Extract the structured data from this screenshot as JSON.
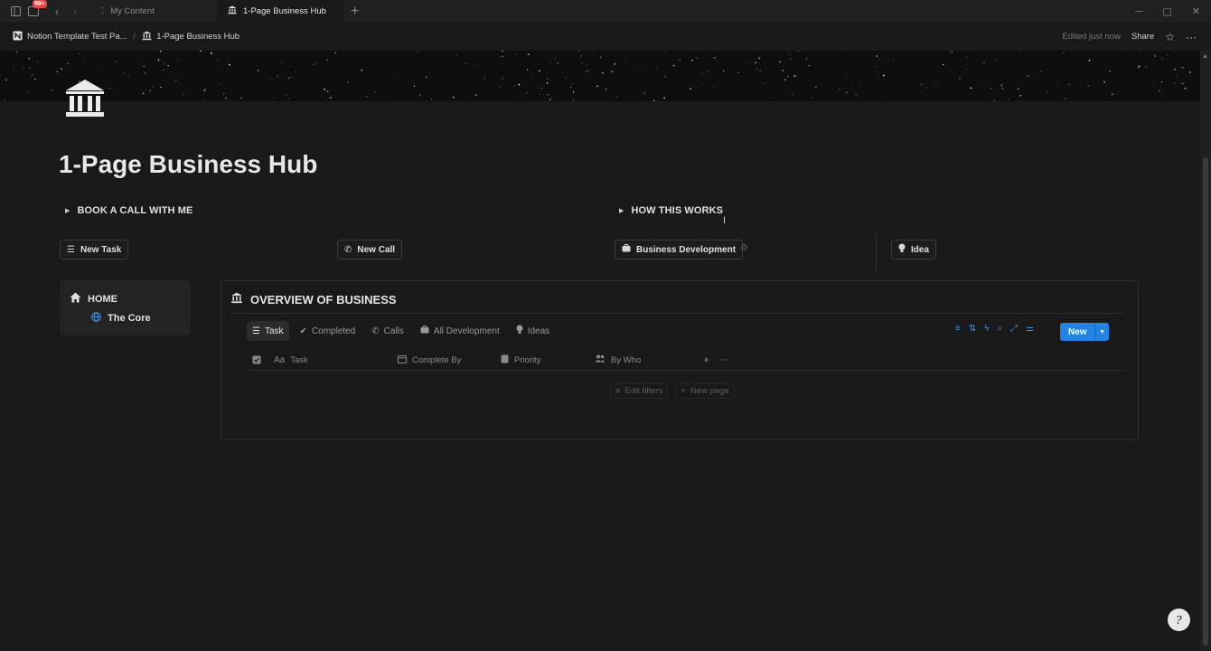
{
  "titlebar": {
    "badge": "99+",
    "tabs": [
      {
        "label": "My Content",
        "icon": "dots-icon",
        "active": false
      },
      {
        "label": "1-Page Business Hub",
        "icon": "bank-icon",
        "active": true
      }
    ],
    "add_tab": "+"
  },
  "topbar": {
    "breadcrumbs": [
      {
        "label": "Notion Template Test Pa...",
        "icon": "notion-icon"
      },
      {
        "label": "1-Page Business Hub",
        "icon": "bank-icon"
      }
    ],
    "edited": "Edited just now",
    "share": "Share"
  },
  "page": {
    "title": "1-Page Business Hub",
    "toggles": [
      "BOOK A CALL WITH ME",
      "HOW THIS WORKS"
    ],
    "buttons": {
      "new_task": "New Task",
      "new_call": "New Call",
      "business_development": "Business Development",
      "idea": "Idea"
    }
  },
  "sidebar": {
    "home": "HOME",
    "core": "The Core"
  },
  "database": {
    "title": "OVERVIEW OF BUSINESS",
    "views": [
      "Task",
      "Completed",
      "Calls",
      "All Development",
      "Ideas"
    ],
    "new_label": "New",
    "columns": [
      "Task",
      "Complete By",
      "Priority",
      "By Who"
    ],
    "edit_filters": "Edit filters",
    "new_page": "New page"
  },
  "colors": {
    "background": "#191919",
    "accent": "#2383e2",
    "badge": "#e04848"
  }
}
